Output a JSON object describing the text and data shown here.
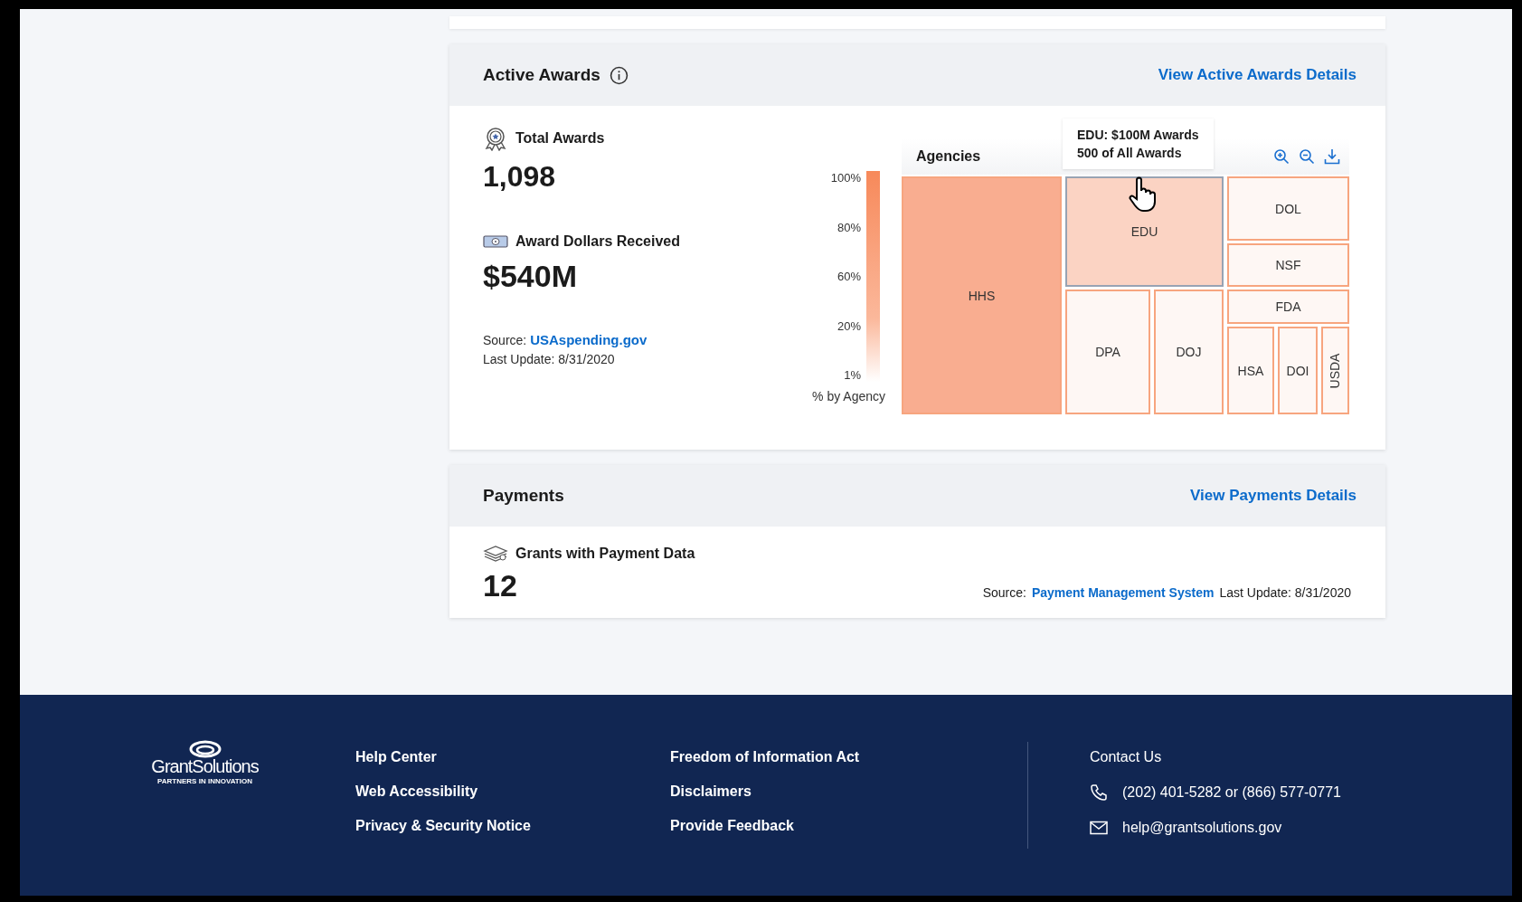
{
  "active_awards": {
    "title": "Active Awards",
    "link": "View Active Awards Details",
    "stats": [
      {
        "kind": "count",
        "label": "Total Awards",
        "value": "1,098"
      },
      {
        "kind": "dollars",
        "label": "Award Dollars Received",
        "value": "$540M"
      }
    ],
    "source_label": "Source:",
    "source_link": "USAspending.gov",
    "last_update": "Last Update: 8/31/2020",
    "legend": {
      "ticks": [
        "100%",
        "80%",
        "60%",
        "20%",
        "1%"
      ],
      "caption": "% by Agency"
    },
    "treemap": {
      "title": "Agencies",
      "tooltip": [
        "EDU: $100M Awards",
        "500 of All Awards"
      ],
      "tiles": [
        {
          "label": "HHS",
          "color": "#f9ad90",
          "selected": false
        },
        {
          "label": "EDU",
          "color": "#fbd3c3",
          "selected": true
        },
        {
          "label": "DOL",
          "color": "#fef7f4",
          "selected": false
        },
        {
          "label": "NSF",
          "color": "#fef7f4",
          "selected": false
        },
        {
          "label": "FDA",
          "color": "#fef7f4",
          "selected": false
        },
        {
          "label": "DPA",
          "color": "#fef7f4",
          "selected": false
        },
        {
          "label": "DOJ",
          "color": "#fef7f4",
          "selected": false
        },
        {
          "label": "HSA",
          "color": "#fef7f4",
          "selected": false
        },
        {
          "label": "DOI",
          "color": "#fef7f4",
          "selected": false
        },
        {
          "label": "USDA",
          "color": "#fef7f4",
          "selected": false
        }
      ]
    }
  },
  "payments": {
    "title": "Payments",
    "link": "View Payments Details",
    "label": "Grants with Payment Data",
    "value": "12",
    "source_label": "Source:",
    "source_link": "Payment Management System",
    "last_update": "Last Update: 8/31/2020"
  },
  "footer": {
    "logo_name": "GrantSolutions",
    "logo_tagline": "PARTNERS IN INNOVATION",
    "links": [
      [
        "Help Center",
        "Web Accessibility",
        "Privacy & Security Notice"
      ],
      [
        "Freedom of Information Act",
        "Disclaimers",
        "Provide Feedback"
      ]
    ],
    "contact_title": "Contact Us",
    "phone": "(202) 401-5282 or (866) 577-0771",
    "email": "help@grantsolutions.gov"
  }
}
